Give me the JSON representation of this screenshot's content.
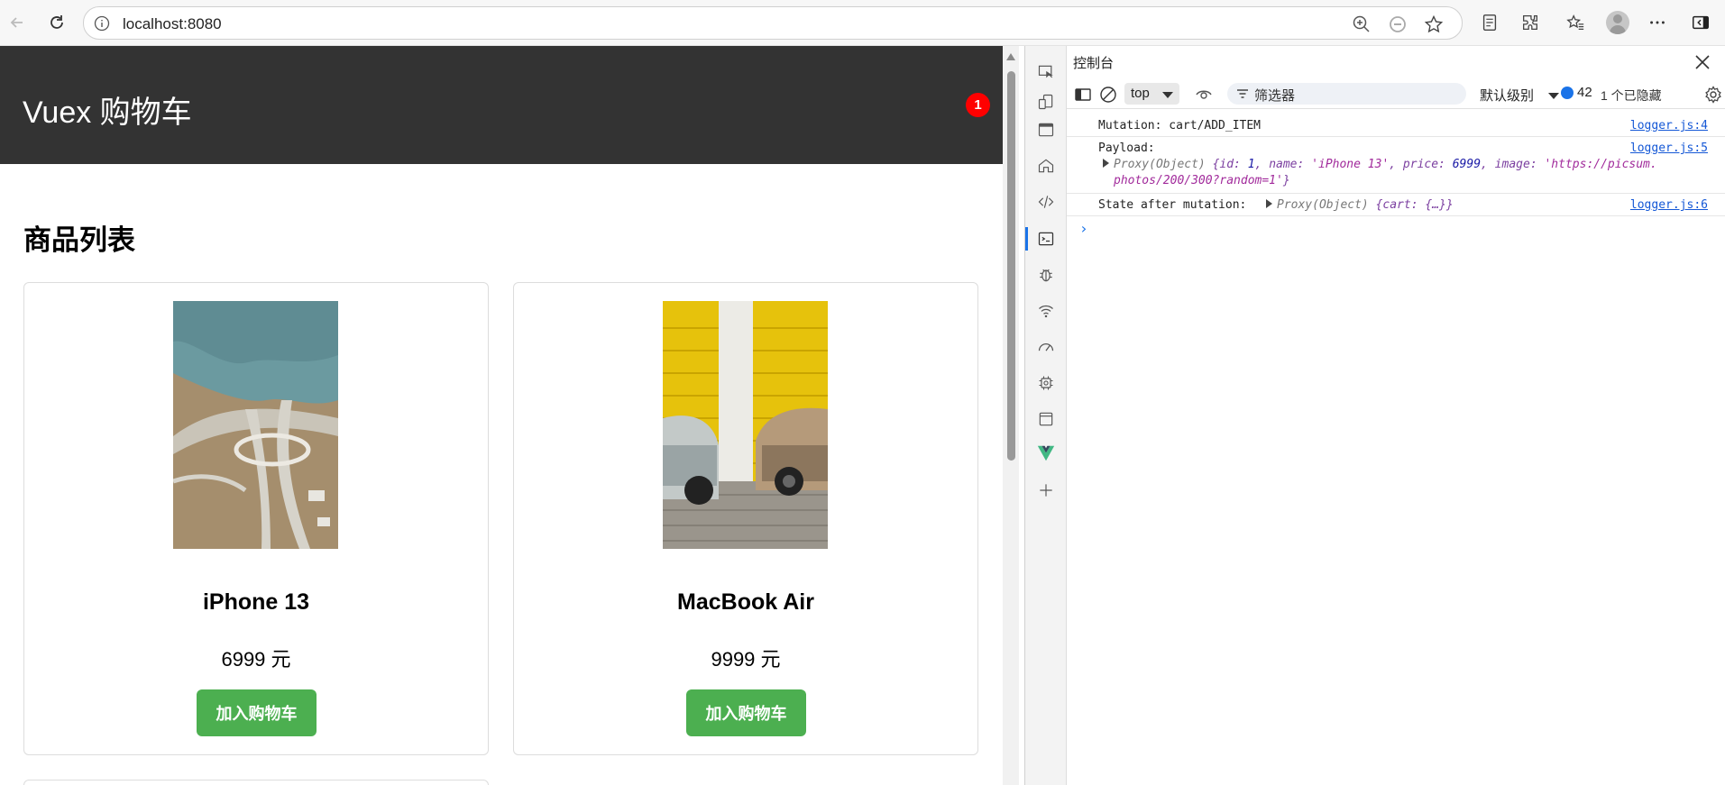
{
  "browser": {
    "url": "localhost:8080"
  },
  "app": {
    "title": "Vuex 购物车",
    "cart_count": "1",
    "section_title": "商品列表",
    "products": [
      {
        "name": "iPhone 13",
        "price": "6999 元",
        "button": "加入购物车"
      },
      {
        "name": "MacBook Air",
        "price": "9999 元",
        "button": "加入购物车"
      }
    ]
  },
  "devtools": {
    "panel_title": "控制台",
    "context": "top",
    "filter_placeholder": "筛选器",
    "log_level": "默认级别",
    "message_count": "42",
    "hidden_count": "1 个已隐藏",
    "logs": [
      {
        "text": "Mutation: cart/ADD_ITEM",
        "source": "logger.js:4"
      },
      {
        "text": "Payload:",
        "source": "logger.js:5"
      },
      {
        "text": "State after mutation:",
        "source": "logger.js:6"
      }
    ],
    "payload": {
      "proxy_label": "Proxy(Object)",
      "id": "1",
      "name": "'iPhone 13'",
      "price": "6999",
      "image_line1": "'https://picsum.",
      "image_line2": "photos/200/300?random=1'"
    },
    "state": {
      "proxy_label": "Proxy(Object)",
      "value": "{cart: {…}}"
    },
    "prompt": "›"
  },
  "colors": {
    "header_bg": "#333333",
    "badge": "#ff0000",
    "button": "#4caf50",
    "link": "#1558d6"
  }
}
